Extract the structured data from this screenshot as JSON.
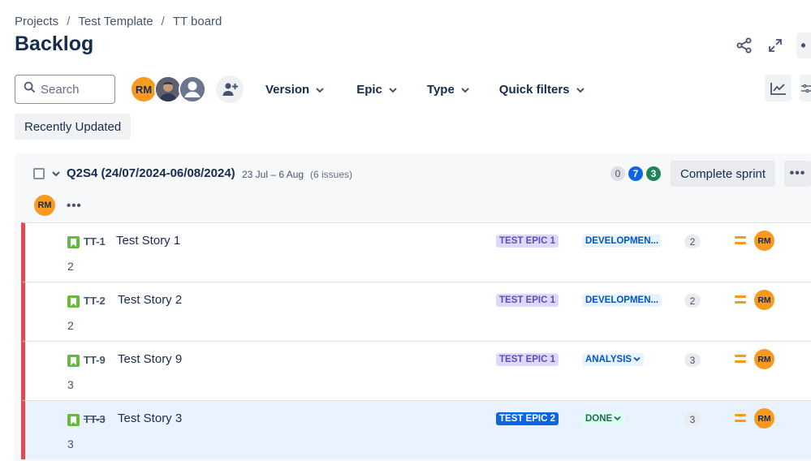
{
  "breadcrumb": {
    "items": [
      "Projects",
      "Test Template",
      "TT board"
    ],
    "separator": "/"
  },
  "page": {
    "title": "Backlog"
  },
  "search": {
    "placeholder": "Search"
  },
  "people": {
    "initials": "RM"
  },
  "filters": {
    "version": "Version",
    "epic": "Epic",
    "type": "Type",
    "quick": "Quick filters"
  },
  "recently_updated": {
    "label": "Recently Updated"
  },
  "sprint": {
    "name": "Q2S4 (24/07/2024-06/08/2024)",
    "dates": "23 Jul – 6 Aug",
    "issue_count": "(6 issues)",
    "counts": {
      "todo": "0",
      "in_progress": "7",
      "done": "3"
    },
    "complete_label": "Complete sprint",
    "assignee_initials": "RM",
    "issues": [
      {
        "key": "TT-1",
        "summary": "Test Story 1",
        "sub": "2",
        "epic": "TEST EPIC 1",
        "status": "DEVELOPMEN...",
        "points": "2",
        "assignee": "RM"
      },
      {
        "key": "TT-2",
        "summary": "Test Story 2",
        "sub": "2",
        "epic": "TEST EPIC 1",
        "status": "DEVELOPMEN...",
        "points": "2",
        "assignee": "RM"
      },
      {
        "key": "TT-9",
        "summary": "Test Story 9",
        "sub": "3",
        "epic": "TEST EPIC 1",
        "status": "ANALYSIS",
        "points": "3",
        "assignee": "RM"
      },
      {
        "key": "TT-3",
        "summary": "Test Story 3",
        "sub": "3",
        "epic": "TEST EPIC 2",
        "status": "DONE",
        "points": "3",
        "assignee": "RM"
      }
    ]
  },
  "colors": {
    "accent": "#0c66e4",
    "issue_bar": "#e5484d",
    "story": "#63ba3c",
    "avatar": "#f79a1f",
    "done_status": "#216e4e",
    "selected_row": "#e9f2ff"
  }
}
